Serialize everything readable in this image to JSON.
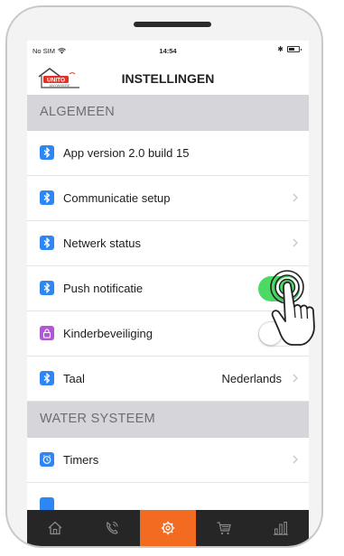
{
  "status_bar": {
    "carrier": "No SIM",
    "time": "14:54",
    "bluetooth": "✱"
  },
  "navbar": {
    "title": "INSTELLINGEN",
    "logo_word": "UNITO",
    "logo_sub": "ANYWHERE"
  },
  "sections": [
    {
      "header": "ALGEMEEN",
      "rows": [
        {
          "label": "App version 2.0 build 15",
          "icon": "bluetooth-icon"
        },
        {
          "label": "Communicatie setup",
          "icon": "bluetooth-icon"
        },
        {
          "label": "Netwerk status",
          "icon": "bluetooth-icon"
        },
        {
          "label": "Push notificatie",
          "icon": "bluetooth-icon",
          "toggle": true
        },
        {
          "label": "Kinderbeveiliging",
          "icon": "lock-icon",
          "toggle": false
        },
        {
          "label": "Taal",
          "icon": "bluetooth-icon",
          "value": "Nederlands"
        }
      ]
    },
    {
      "header": "WATER SYSTEEM",
      "rows": [
        {
          "label": "Timers",
          "icon": "clock-icon"
        }
      ]
    }
  ],
  "tab_bar": {
    "tabs": [
      "home-icon",
      "phone-icon",
      "gear-icon",
      "cart-icon",
      "bar-chart-icon"
    ],
    "active": "gear-icon"
  },
  "colors": {
    "accent_orange": "#f36a21",
    "toggle_on": "#4cd964",
    "icon_blue": "#2e86f5",
    "icon_purple": "#b057d6",
    "section_header_bg": "#d6d5da",
    "tab_bar_bg": "#262626"
  }
}
